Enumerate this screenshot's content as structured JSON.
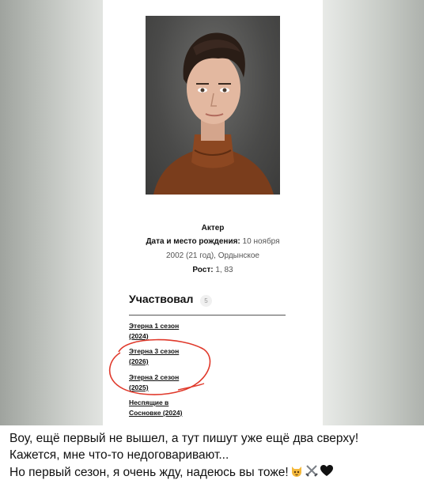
{
  "profile": {
    "role": "Актер",
    "birth_label": "Дата и место рождения:",
    "birth_value_line1": "10 ноября",
    "birth_value_line2": "2002 (21 год), Ордынское",
    "height_label": "Рост:",
    "height_value": "1, 83"
  },
  "filmography": {
    "title": "Участвовал",
    "count": "5",
    "items": [
      {
        "line1": "Этерна 1 сезон",
        "line2": "(2024)"
      },
      {
        "line1": "Этерна 3 сезон",
        "line2": "(2026)"
      },
      {
        "line1": "Этерна 2 сезон",
        "line2": "(2025)"
      },
      {
        "line1": "Неспящие в",
        "line2": "Сосновке (2024)"
      }
    ]
  },
  "message": {
    "line1": "Воу, ещё первый не вышел, а тут пишут уже ещё два сверху!",
    "line2": "Кажется, мне что-то недоговаривают...",
    "line3": "Но первый сезон, я очень жду, надеюсь вы тоже!",
    "emojis": [
      "cat-face-icon",
      "crossed-swords-icon",
      "black-heart-icon"
    ]
  },
  "colors": {
    "annotation_circle": "#e0392b"
  }
}
